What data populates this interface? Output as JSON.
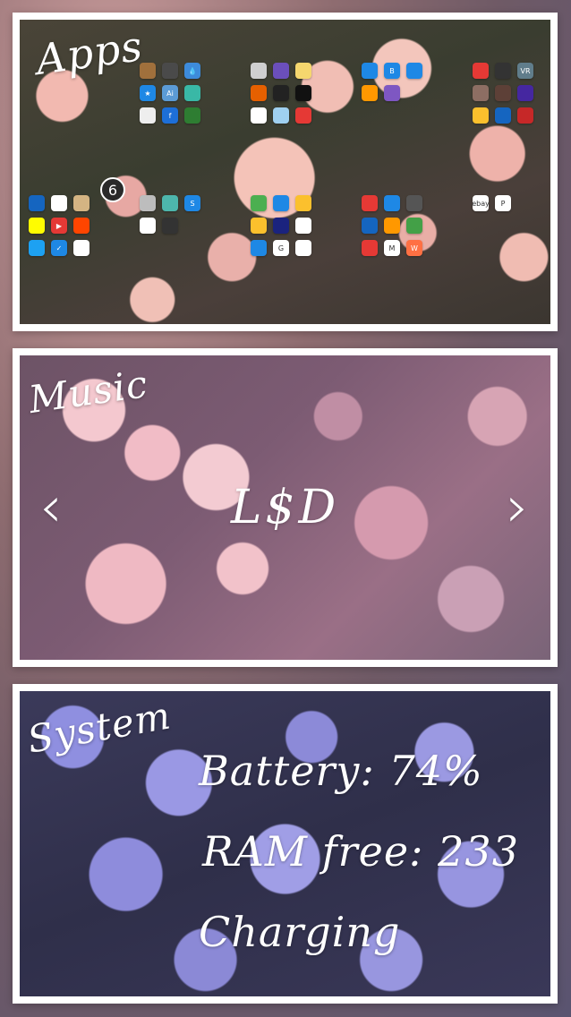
{
  "apps_panel": {
    "title": "Apps",
    "badge_count": "6",
    "folders": [
      {
        "icons": [
          {
            "name": "brown-app-icon",
            "color": "#a0703c",
            "glyph": ""
          },
          {
            "name": "sd-card-app-icon",
            "color": "#4a4a4a",
            "glyph": ""
          },
          {
            "name": "water-drop-app-icon",
            "color": "#3d8bdb",
            "glyph": "💧"
          },
          {
            "name": "star-app-icon",
            "color": "#1e88e5",
            "glyph": "★"
          },
          {
            "name": "blue-ai-app-icon",
            "color": "#5b9bd5",
            "glyph": "Ai"
          },
          {
            "name": "teal-app-icon",
            "color": "#39b8a6",
            "glyph": ""
          },
          {
            "name": "drill-app-icon",
            "color": "#eeeeee",
            "glyph": ""
          },
          {
            "name": "flux-app-icon",
            "color": "#1d6fd8",
            "glyph": "f"
          },
          {
            "name": "green-graph-app-icon",
            "color": "#2e7d32",
            "glyph": ""
          }
        ]
      },
      {
        "icons": [
          {
            "name": "gray-circle-app-icon",
            "color": "#cfcfcf",
            "glyph": ""
          },
          {
            "name": "colorful-ring-app-icon",
            "color": "#6b4fbb",
            "glyph": ""
          },
          {
            "name": "yellow-frame-app-icon",
            "color": "#f5d76e",
            "glyph": ""
          },
          {
            "name": "firefox-app-icon",
            "color": "#e66000",
            "glyph": ""
          },
          {
            "name": "camera-app-icon",
            "color": "#222222",
            "glyph": ""
          },
          {
            "name": "dark-app-icon",
            "color": "#111111",
            "glyph": ""
          },
          {
            "name": "qr-app-icon",
            "color": "#ffffff",
            "glyph": ""
          },
          {
            "name": "pastel-app-icon",
            "color": "#9fd0f0",
            "glyph": ""
          },
          {
            "name": "crop-app-icon",
            "color": "#e53935",
            "glyph": ""
          }
        ]
      },
      {
        "icons": [
          {
            "name": "blue-gear-app-icon",
            "color": "#1e88e5",
            "glyph": ""
          },
          {
            "name": "b-app-icon",
            "color": "#1e88e5",
            "glyph": "B"
          },
          {
            "name": "cart-app-icon",
            "color": "#1e88e5",
            "glyph": ""
          },
          {
            "name": "orange-ring-app-icon",
            "color": "#ff9800",
            "glyph": ""
          },
          {
            "name": "purple-drop-app-icon",
            "color": "#7e57c2",
            "glyph": ""
          }
        ]
      },
      {
        "icons": [
          {
            "name": "pokeball-app-icon",
            "color": "#e53935",
            "glyph": ""
          },
          {
            "name": "game-app-icon",
            "color": "#333333",
            "glyph": ""
          },
          {
            "name": "vr-app-icon",
            "color": "#607d8b",
            "glyph": "VR"
          },
          {
            "name": "character-app-icon",
            "color": "#8d6e63",
            "glyph": ""
          },
          {
            "name": "shooter-app-icon",
            "color": "#5d4037",
            "glyph": ""
          },
          {
            "name": "purple-game-app-icon",
            "color": "#4527a0",
            "glyph": ""
          },
          {
            "name": "face-game-app-icon",
            "color": "#fbc02d",
            "glyph": ""
          },
          {
            "name": "sonic-app-icon",
            "color": "#1565c0",
            "glyph": ""
          },
          {
            "name": "red-game-app-icon",
            "color": "#c62828",
            "glyph": ""
          }
        ]
      },
      {
        "icons": [
          {
            "name": "blue-app-icon",
            "color": "#1565c0",
            "glyph": ""
          },
          {
            "name": "messenger-app-icon",
            "color": "#ffffff",
            "glyph": ""
          },
          {
            "name": "camera-vintage-app-icon",
            "color": "#d4b483",
            "glyph": ""
          },
          {
            "name": "snapchat-app-icon",
            "color": "#fffc00",
            "glyph": ""
          },
          {
            "name": "youtube-app-icon",
            "color": "#e53935",
            "glyph": "▶"
          },
          {
            "name": "reddit-app-icon",
            "color": "#ff4500",
            "glyph": ""
          },
          {
            "name": "twitter-app-icon",
            "color": "#1da1f2",
            "glyph": ""
          },
          {
            "name": "check-app-icon",
            "color": "#1e88e5",
            "glyph": "✓"
          },
          {
            "name": "stripe-app-icon",
            "color": "#ffffff",
            "glyph": ""
          }
        ]
      },
      {
        "icons": [
          {
            "name": "gray-app-icon",
            "color": "#bdbdbd",
            "glyph": ""
          },
          {
            "name": "landscape-app-icon",
            "color": "#4db6ac",
            "glyph": ""
          },
          {
            "name": "s-app-icon",
            "color": "#1e88e5",
            "glyph": "S"
          },
          {
            "name": "white-app-icon",
            "color": "#ffffff",
            "glyph": ""
          },
          {
            "name": "dark-photo-app-icon",
            "color": "#333333",
            "glyph": ""
          }
        ]
      },
      {
        "icons": [
          {
            "name": "maps-app-icon",
            "color": "#4caf50",
            "glyph": ""
          },
          {
            "name": "docs-app-icon",
            "color": "#1e88e5",
            "glyph": ""
          },
          {
            "name": "slides-app-icon",
            "color": "#fbc02d",
            "glyph": ""
          },
          {
            "name": "keep-app-icon",
            "color": "#fbc02d",
            "glyph": ""
          },
          {
            "name": "earth-app-icon",
            "color": "#1a237e",
            "glyph": ""
          },
          {
            "name": "photos-app-icon",
            "color": "#ffffff",
            "glyph": ""
          },
          {
            "name": "inbox-app-icon",
            "color": "#1e88e5",
            "glyph": ""
          },
          {
            "name": "google-app-icon",
            "color": "#ffffff",
            "glyph": "G"
          },
          {
            "name": "chrome-app-icon",
            "color": "#ffffff",
            "glyph": ""
          }
        ]
      },
      {
        "icons": [
          {
            "name": "opera-app-icon",
            "color": "#e53935",
            "glyph": ""
          },
          {
            "name": "blue-bars-app-icon",
            "color": "#1e88e5",
            "glyph": ""
          },
          {
            "name": "wifi-app-icon",
            "color": "#555555",
            "glyph": ""
          },
          {
            "name": "bus-app-icon",
            "color": "#1565c0",
            "glyph": ""
          },
          {
            "name": "orange-app-icon",
            "color": "#ff9800",
            "glyph": ""
          },
          {
            "name": "green-ring-app-icon",
            "color": "#43a047",
            "glyph": ""
          },
          {
            "name": "train-app-icon",
            "color": "#e53935",
            "glyph": ""
          },
          {
            "name": "gmail-app-icon",
            "color": "#ffffff",
            "glyph": "M"
          },
          {
            "name": "w-app-icon",
            "color": "#ff7043",
            "glyph": "W"
          }
        ]
      },
      {
        "icons": [
          {
            "name": "ebay-app-icon",
            "color": "#ffffff",
            "glyph": "ebay"
          },
          {
            "name": "paypal-app-icon",
            "color": "#ffffff",
            "glyph": "P"
          }
        ]
      }
    ]
  },
  "music_panel": {
    "title": "Music",
    "track": "L$D",
    "prev_label": "‹",
    "next_label": "›"
  },
  "system_panel": {
    "title": "System",
    "battery": "Battery: 74%",
    "ram": "RAM free: 233",
    "status": "Charging"
  }
}
